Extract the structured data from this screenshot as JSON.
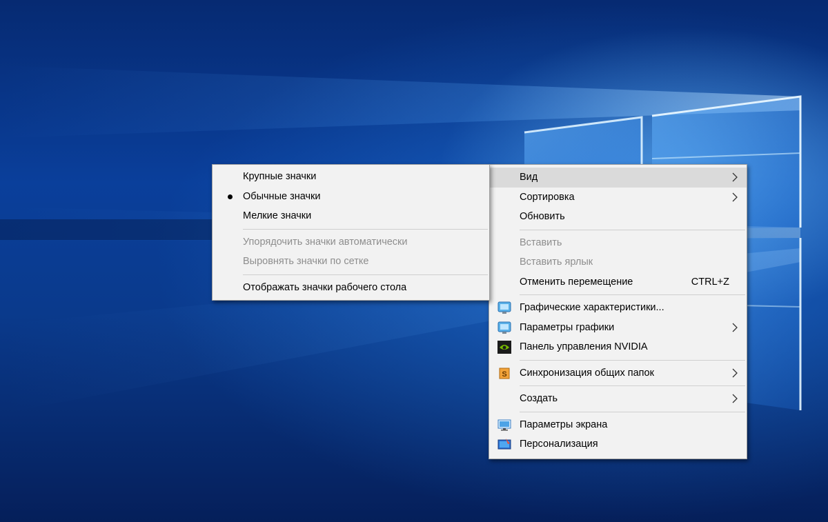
{
  "context_menu": {
    "items": [
      {
        "label": "Вид",
        "state": "hover",
        "has_submenu": true
      },
      {
        "label": "Сортировка",
        "has_submenu": true
      },
      {
        "label": "Обновить"
      },
      {
        "label": "Вставить",
        "state": "disabled"
      },
      {
        "label": "Вставить ярлык",
        "state": "disabled"
      },
      {
        "label": "Отменить перемещение",
        "shortcut": "CTRL+Z"
      },
      {
        "label": "Графические характеристики...",
        "icon": "intel-graphics-icon"
      },
      {
        "label": "Параметры графики",
        "icon": "intel-graphics-icon",
        "has_submenu": true
      },
      {
        "label": "Панель управления NVIDIA",
        "icon": "nvidia-icon"
      },
      {
        "label": "Синхронизация общих папок",
        "icon": "sync-folders-icon",
        "has_submenu": true
      },
      {
        "label": "Создать",
        "has_submenu": true
      },
      {
        "label": "Параметры экрана",
        "icon": "display-settings-icon"
      },
      {
        "label": "Персонализация",
        "icon": "personalization-icon"
      }
    ]
  },
  "view_submenu": {
    "items": [
      {
        "label": "Крупные значки"
      },
      {
        "label": "Обычные значки",
        "checked": true
      },
      {
        "label": "Мелкие значки"
      },
      {
        "label": "Упорядочить значки автоматически",
        "state": "disabled"
      },
      {
        "label": "Выровнять значки по сетке",
        "state": "disabled"
      },
      {
        "label": "Отображать значки рабочего стола"
      }
    ]
  },
  "colors": {
    "menu_bg": "#f2f2f2",
    "hover_bg": "#dadada",
    "disabled_text": "#8d8d8d",
    "wallpaper_blue": "#0a3f9b"
  }
}
